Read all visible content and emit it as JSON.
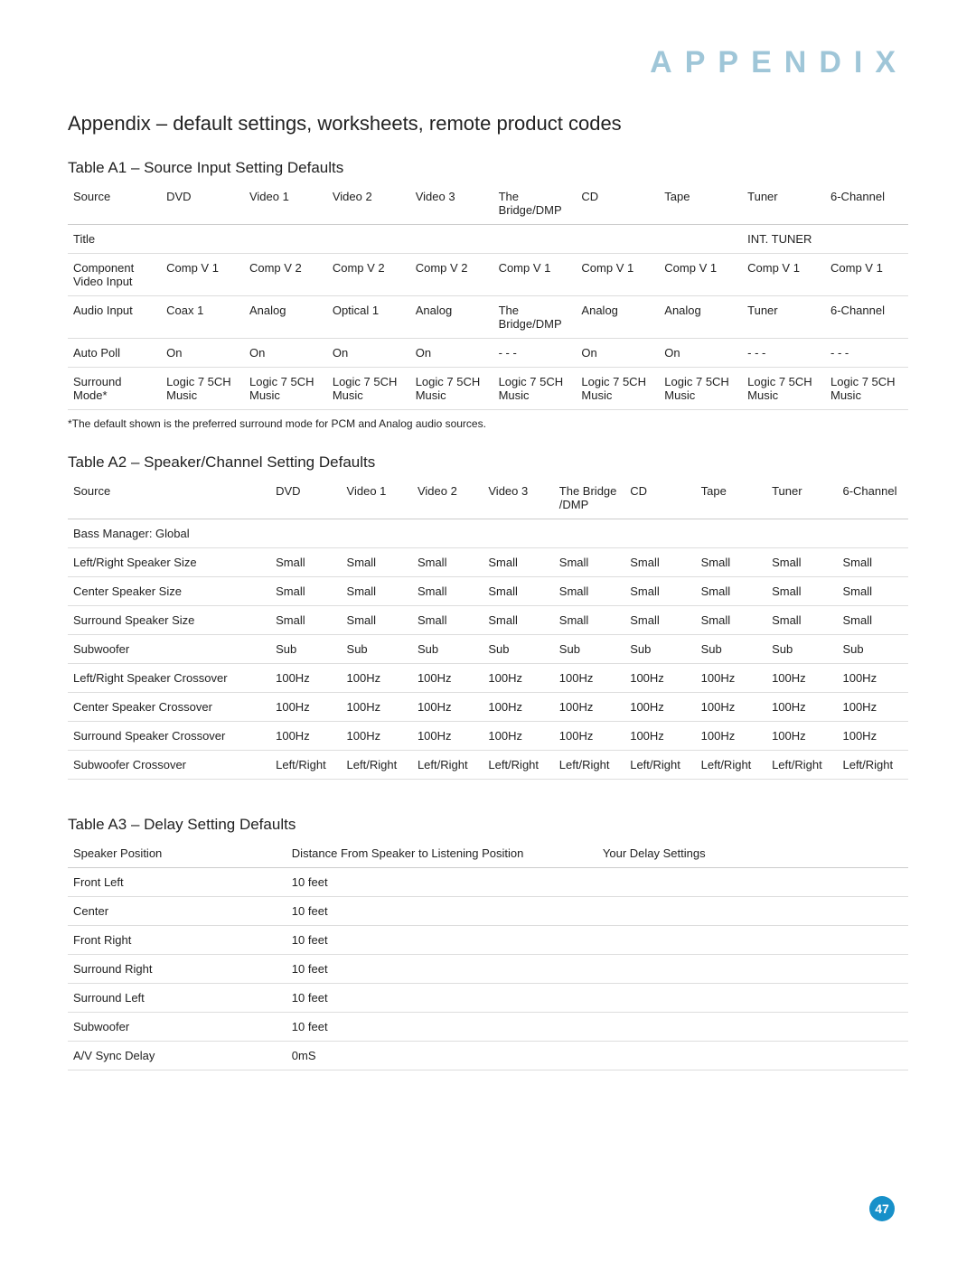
{
  "header": "APPENDIX",
  "title": "Appendix – default settings, worksheets, remote product codes",
  "page_number": "47",
  "table_a1": {
    "title": "Table A1 – Source Input Setting Defaults",
    "columns": [
      "Source",
      "DVD",
      "Video 1",
      "Video 2",
      "Video 3",
      "The Bridge/DMP",
      "CD",
      "Tape",
      "Tuner",
      "6-Channel"
    ],
    "rows": [
      {
        "label": "Title",
        "cells": [
          "",
          "",
          "",
          "",
          "",
          "",
          "",
          "INT. TUNER",
          ""
        ]
      },
      {
        "label": "Component Video Input",
        "cells": [
          "Comp V 1",
          "Comp V 2",
          "Comp V 2",
          "Comp V 2",
          "Comp V 1",
          "Comp V 1",
          "Comp V 1",
          "Comp V 1",
          "Comp V 1"
        ]
      },
      {
        "label": "Audio Input",
        "cells": [
          "Coax 1",
          "Analog",
          "Optical 1",
          "Analog",
          "The Bridge/DMP",
          "Analog",
          "Analog",
          "Tuner",
          "6-Channel"
        ]
      },
      {
        "label": "Auto Poll",
        "cells": [
          "On",
          "On",
          "On",
          "On",
          "- - -",
          "On",
          "On",
          "- - -",
          "- - -"
        ]
      },
      {
        "label": "Surround Mode*",
        "cells": [
          "Logic 7 5CH Music",
          "Logic 7 5CH Music",
          "Logic 7 5CH Music",
          "Logic 7 5CH Music",
          "Logic 7 5CH Music",
          "Logic 7 5CH Music",
          "Logic 7 5CH Music",
          "Logic 7 5CH Music",
          "Logic 7 5CH Music"
        ]
      }
    ],
    "footnote": "*The default shown is the preferred surround mode for PCM and Analog audio sources."
  },
  "table_a2": {
    "title": "Table A2 – Speaker/Channel Setting Defaults",
    "columns": [
      "Source",
      "DVD",
      "Video 1",
      "Video 2",
      "Video 3",
      "The Bridge /DMP",
      "CD",
      "Tape",
      "Tuner",
      "6-Channel"
    ],
    "rows": [
      {
        "label": "Bass Manager: Global",
        "cells": [
          "",
          "",
          "",
          "",
          "",
          "",
          "",
          "",
          ""
        ]
      },
      {
        "label": "Left/Right Speaker Size",
        "cells": [
          "Small",
          "Small",
          "Small",
          "Small",
          "Small",
          "Small",
          "Small",
          "Small",
          "Small"
        ]
      },
      {
        "label": "Center Speaker Size",
        "cells": [
          "Small",
          "Small",
          "Small",
          "Small",
          "Small",
          "Small",
          "Small",
          "Small",
          "Small"
        ]
      },
      {
        "label": "Surround Speaker Size",
        "cells": [
          "Small",
          "Small",
          "Small",
          "Small",
          "Small",
          "Small",
          "Small",
          "Small",
          "Small"
        ]
      },
      {
        "label": "Subwoofer",
        "cells": [
          "Sub",
          "Sub",
          "Sub",
          "Sub",
          "Sub",
          "Sub",
          "Sub",
          "Sub",
          "Sub"
        ]
      },
      {
        "label": "Left/Right Speaker Crossover",
        "cells": [
          "100Hz",
          "100Hz",
          "100Hz",
          "100Hz",
          "100Hz",
          "100Hz",
          "100Hz",
          "100Hz",
          "100Hz"
        ]
      },
      {
        "label": "Center Speaker Crossover",
        "cells": [
          "100Hz",
          "100Hz",
          "100Hz",
          "100Hz",
          "100Hz",
          "100Hz",
          "100Hz",
          "100Hz",
          "100Hz"
        ]
      },
      {
        "label": "Surround Speaker Crossover",
        "cells": [
          "100Hz",
          "100Hz",
          "100Hz",
          "100Hz",
          "100Hz",
          "100Hz",
          "100Hz",
          "100Hz",
          "100Hz"
        ]
      },
      {
        "label": "Subwoofer Crossover",
        "cells": [
          "Left/Right",
          "Left/Right",
          "Left/Right",
          "Left/Right",
          "Left/Right",
          "Left/Right",
          "Left/Right",
          "Left/Right",
          "Left/Right"
        ]
      }
    ]
  },
  "table_a3": {
    "title": "Table A3 – Delay Setting Defaults",
    "columns": [
      "Speaker Position",
      "Distance From Speaker to Listening Position",
      "Your Delay Settings"
    ],
    "rows": [
      {
        "cells": [
          "Front Left",
          "10 feet",
          ""
        ]
      },
      {
        "cells": [
          "Center",
          "10 feet",
          ""
        ]
      },
      {
        "cells": [
          "Front Right",
          "10 feet",
          ""
        ]
      },
      {
        "cells": [
          "Surround Right",
          "10 feet",
          ""
        ]
      },
      {
        "cells": [
          "Surround Left",
          "10 feet",
          ""
        ]
      },
      {
        "cells": [
          "Subwoofer",
          "10 feet",
          ""
        ]
      },
      {
        "cells": [
          "A/V Sync Delay",
          "0mS",
          ""
        ]
      }
    ]
  }
}
